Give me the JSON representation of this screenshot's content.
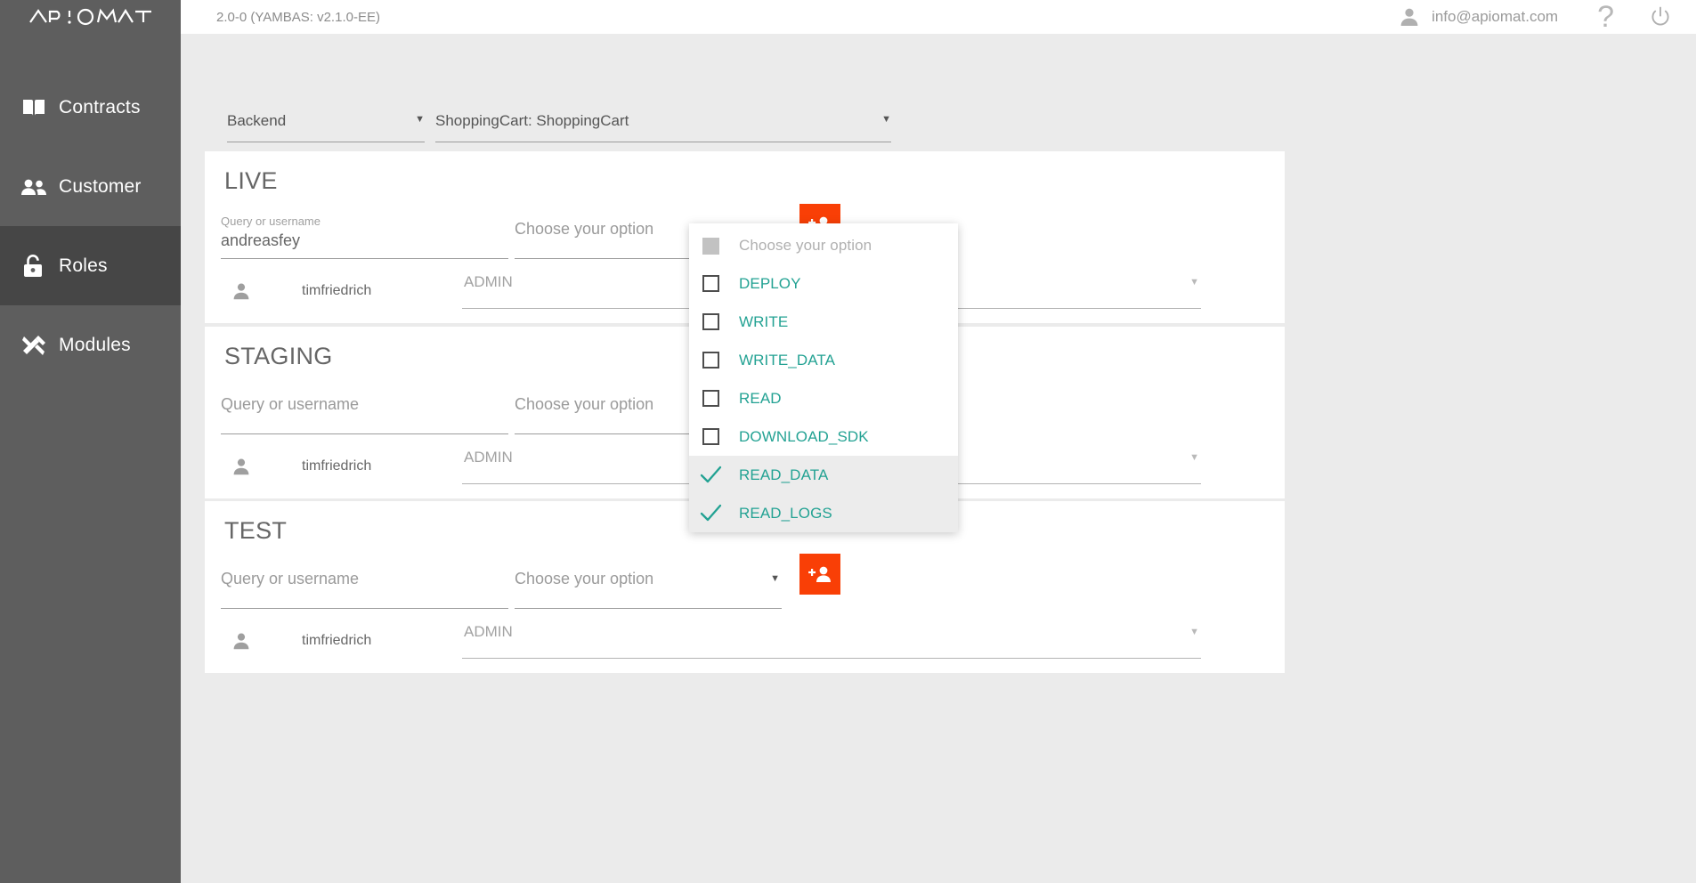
{
  "app": {
    "logo_text": "APiOMAT",
    "version": "2.0-0 (YAMBAS: v2.1.0-EE)",
    "user_email": "info@apiomat.com",
    "help_glyph": "?",
    "accent_orange": "#f93f06",
    "accent_teal": "#23a293",
    "sidebar_bg": "#5e5e5e",
    "sidebar_active_bg": "#464646"
  },
  "sidebar": {
    "items": [
      {
        "label": "Contracts",
        "icon": "book-icon",
        "active": false
      },
      {
        "label": "Customer",
        "icon": "people-icon",
        "active": false
      },
      {
        "label": "Roles",
        "icon": "lock-icon",
        "active": true
      },
      {
        "label": "Modules",
        "icon": "tools-icon",
        "active": false
      }
    ]
  },
  "selectors": {
    "backend": {
      "value": "Backend",
      "caret": "▼"
    },
    "module": {
      "value": "ShoppingCart: ShoppingCart",
      "caret": "▼"
    }
  },
  "cards": [
    {
      "title": "LIVE",
      "query": {
        "label": "Query or username",
        "value": "andreasfey",
        "placeholder": "Query or username"
      },
      "option": {
        "placeholder": "Choose your option",
        "caret": "▼",
        "open": true
      },
      "add_button": "add-user",
      "rows": [
        {
          "user": "timfriedrich",
          "role": "ADMIN",
          "caret": "▼"
        }
      ]
    },
    {
      "title": "STAGING",
      "query": {
        "label": "",
        "value": "",
        "placeholder": "Query or username"
      },
      "option": {
        "placeholder": "Choose your option",
        "caret": "▼",
        "open": false
      },
      "add_button": "add-user",
      "rows": [
        {
          "user": "timfriedrich",
          "role": "ADMIN",
          "caret": "▼"
        }
      ]
    },
    {
      "title": "TEST",
      "query": {
        "label": "",
        "value": "",
        "placeholder": "Query or username"
      },
      "option": {
        "placeholder": "Choose your option",
        "caret": "▼",
        "open": false
      },
      "add_button": "add-user",
      "rows": [
        {
          "user": "timfriedrich",
          "role": "ADMIN",
          "caret": "▼"
        }
      ]
    }
  ],
  "dropdown": {
    "placeholder": "Choose your option",
    "options": [
      {
        "label": "DEPLOY",
        "checked": false
      },
      {
        "label": "WRITE",
        "checked": false
      },
      {
        "label": "WRITE_DATA",
        "checked": false
      },
      {
        "label": "READ",
        "checked": false
      },
      {
        "label": "DOWNLOAD_SDK",
        "checked": false
      },
      {
        "label": "READ_DATA",
        "checked": true
      },
      {
        "label": "READ_LOGS",
        "checked": true
      }
    ]
  }
}
